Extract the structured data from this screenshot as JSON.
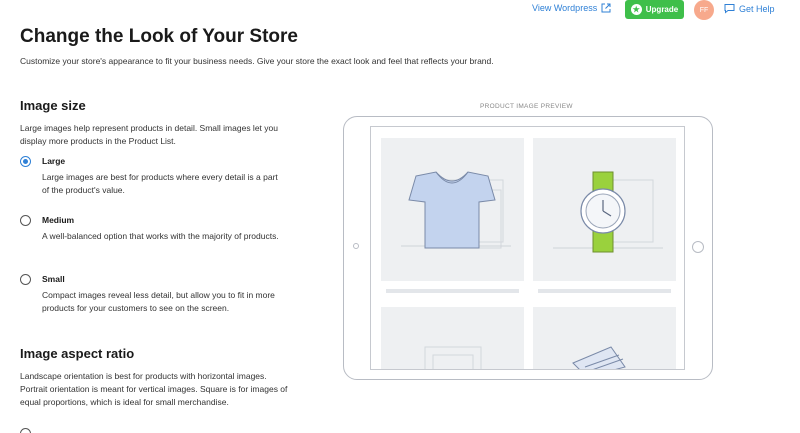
{
  "topbar": {
    "view_wordpress": "View Wordpress",
    "upgrade": "Upgrade",
    "avatar_initials": "FF",
    "get_help": "Get Help",
    "icons": {
      "external": "external-link-icon",
      "star": "star-icon",
      "help": "help-chat-icon"
    }
  },
  "header": {
    "title": "Change the Look of Your Store",
    "description": "Customize your store's appearance to fit your business needs. Give your store the exact look and feel that reflects your brand."
  },
  "image_size": {
    "title": "Image size",
    "description": "Large images help represent products in detail. Small images let you display more products in the Product List.",
    "selected": "Large",
    "options": [
      {
        "label": "Large",
        "description": "Large images are best for products where every detail is a part of the product's value."
      },
      {
        "label": "Medium",
        "description": "A well-balanced option that works with the majority of products."
      },
      {
        "label": "Small",
        "description": "Compact images reveal less detail, but allow you to fit in more products for your customers to see on the screen."
      }
    ]
  },
  "aspect_ratio": {
    "title": "Image aspect ratio",
    "description": "Landscape orientation is best for products with horizontal images. Portrait orientation is meant for vertical images. Square is for images of equal proportions, which is ideal for small merchandise."
  },
  "preview": {
    "label": "PRODUCT IMAGE PREVIEW"
  },
  "colors": {
    "accent": "#2f80d6",
    "upgrade": "#3fbf4a",
    "avatar": "#f7a98c",
    "watch_band": "#9ad13d",
    "shirt": "#c3d3ee"
  }
}
